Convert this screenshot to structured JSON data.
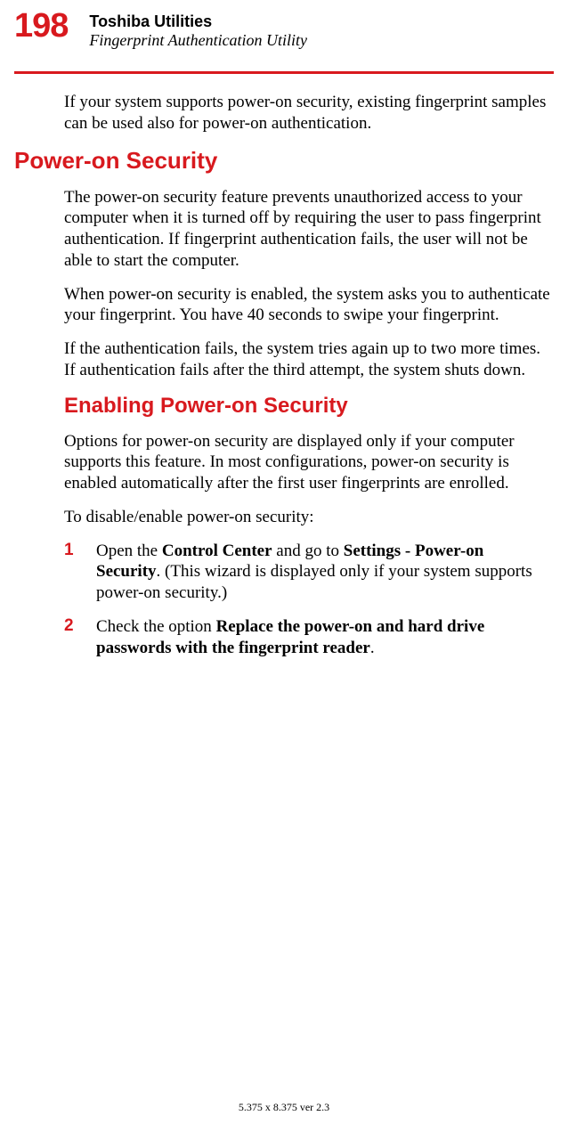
{
  "header": {
    "page_number": "198",
    "title": "Toshiba Utilities",
    "subtitle": "Fingerprint Authentication Utility"
  },
  "intro_para": "If your system supports power-on security, existing fingerprint samples can be used also for power-on authentication.",
  "section1": {
    "heading": "Power-on Security",
    "para1": "The power-on security feature prevents unauthorized access to your computer when it is turned off by requiring the user to pass fingerprint authentication. If fingerprint authentication fails, the user will not be able to start the computer.",
    "para2": "When power-on security is enabled, the system asks you to authenticate your fingerprint. You have 40 seconds to swipe your fingerprint.",
    "para3": "If the authentication fails, the system tries again up to two more times. If authentication fails after the third attempt, the system shuts down."
  },
  "section2": {
    "heading": "Enabling Power-on Security",
    "para1": "Options for power-on security are displayed only if your computer supports this feature. In most configurations, power-on security is enabled automatically after the first user fingerprints are enrolled.",
    "para2": "To disable/enable power-on security:",
    "steps": [
      {
        "num": "1",
        "pre": "Open the ",
        "b1": "Control Center",
        "mid": " and go to ",
        "b2": "Settings - Power-on Security",
        "post": ". (This wizard is displayed only if your system supports power-on security.)"
      },
      {
        "num": "2",
        "pre": "Check the option ",
        "b1": "Replace the power-on and hard drive passwords with the fingerprint reader",
        "post": "."
      }
    ]
  },
  "footer": "5.375 x 8.375 ver 2.3"
}
